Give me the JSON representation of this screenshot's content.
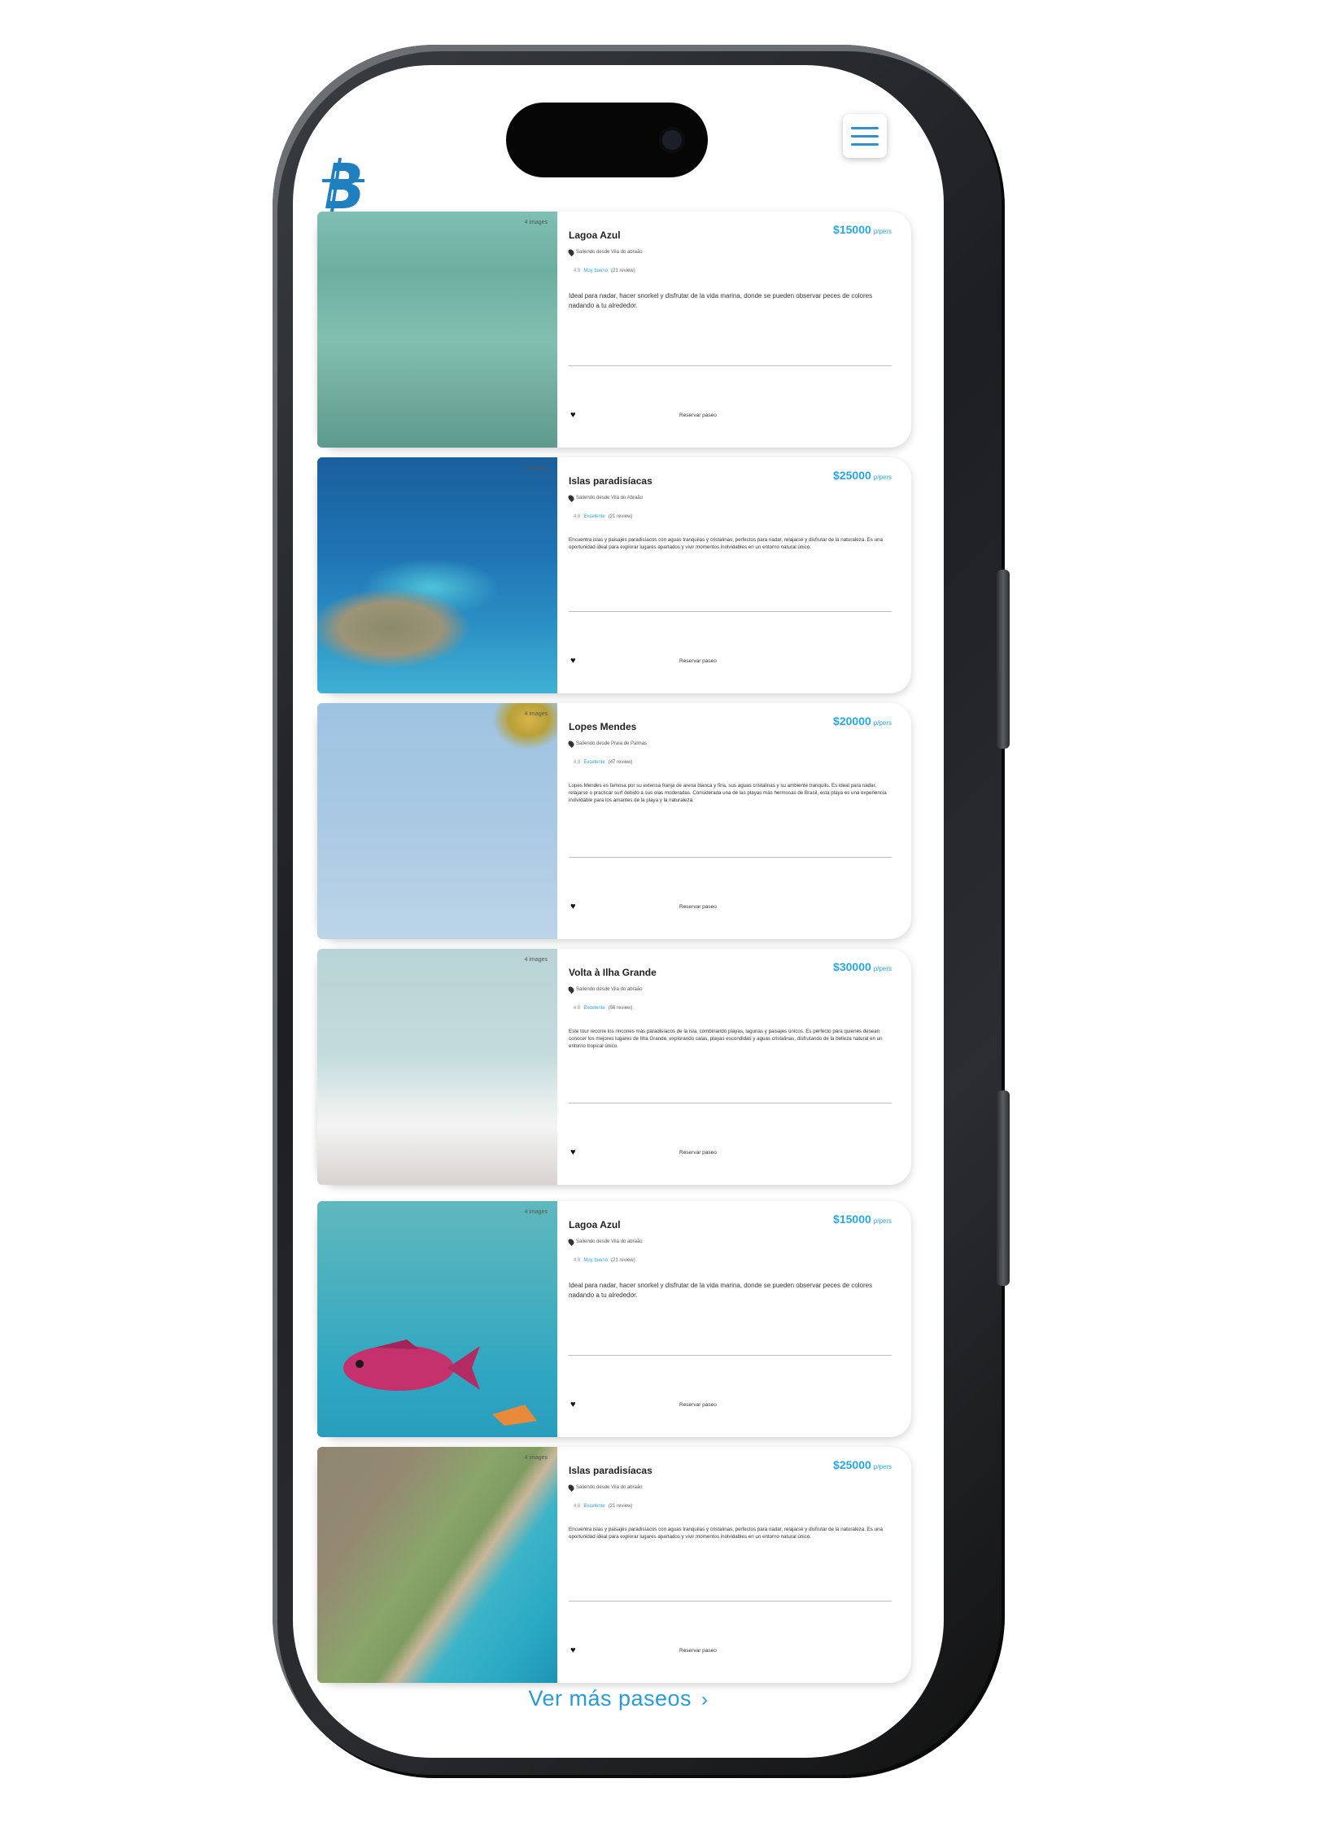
{
  "header": {
    "logo_icon": "brand-b-logo-icon",
    "menu_icon": "hamburger-menu-icon"
  },
  "accent_color": "#2aa6e0",
  "cards": [
    {
      "image_tag": "4 images",
      "title": "Lagoa Azul",
      "price": "$15000",
      "price_unit": "p/pers",
      "location": "Saliendo desde Vila do abraão",
      "rating_score": "4.9",
      "rating_label": "Muy bueno",
      "rating_reviews": "(21 review)",
      "description": "Ideal para nadar, hacer snorkel y disfrutar de la vida marina, donde se pueden observar peces de colores nadando a tu alrededor.",
      "reserve_label": "Reservar paseo"
    },
    {
      "image_tag": "4 images",
      "title": "Islas paradisíacas",
      "price": "$25000",
      "price_unit": "p/pers",
      "location": "Saliendo desde Vila do Abraão",
      "rating_score": "4.8",
      "rating_label": "Excelente",
      "rating_reviews": "(21 review)",
      "description": "Encuentra islas y paisajes paradisíacos con aguas tranquilas y cristalinas, perfectos para nadar, relajarse y disfrutar de la naturaleza. Es una oportunidad ideal para explorar lugares apartados y vivir momentos inolvidables en un entorno natural único.",
      "reserve_label": "Reservar paseo"
    },
    {
      "image_tag": "4 images",
      "title": "Lopes Mendes",
      "price": "$20000",
      "price_unit": "p/pers",
      "location": "Saliendo desde Praia de Palmas",
      "rating_score": "4.9",
      "rating_label": "Excelente",
      "rating_reviews": "(47 review)",
      "description": "Lopes Mendes es famosa por su extensa franja de arena blanca y fina, sus aguas cristalinas y su ambiente tranquilo. Es ideal para nadar, relajarse o practicar surf debido a sus olas moderadas. Considerada una de las playas más hermosas de Brasil, esta playa es una experiencia inolvidable para los amantes de la playa y la naturaleza.",
      "reserve_label": "Reservar paseo"
    },
    {
      "image_tag": "4 images",
      "title": "Volta à Ilha Grande",
      "price": "$30000",
      "price_unit": "p/pers",
      "location": "Saliendo desde Vila do abraão",
      "rating_score": "4.8",
      "rating_label": "Excelente",
      "rating_reviews": "(56 review)",
      "description": "Este tour recorre los rincones más paradisíacos de la isla, combinando playas, lagunas y paisajes únicos. Es perfecto para quienes desean conocer los mejores lugares de Ilha Grande, explorando calas, playas escondidas y aguas cristalinas, disfrutando de la belleza natural en un entorno tropical único.",
      "reserve_label": "Reservar paseo"
    },
    {
      "image_tag": "4 images",
      "title": "Lagoa Azul",
      "price": "$15000",
      "price_unit": "p/pers",
      "location": "Saliendo desde Vila do abraão",
      "rating_score": "4.9",
      "rating_label": "Muy bueno",
      "rating_reviews": "(21 review)",
      "description": "Ideal para nadar, hacer snorkel y disfrutar de la vida marina, donde se pueden observar peces de colores nadando a tu alrededor.",
      "reserve_label": "Reservar paseo"
    },
    {
      "image_tag": "4 images",
      "title": "Islas paradisíacas",
      "price": "$25000",
      "price_unit": "p/pers",
      "location": "Saliendo desde Vila do abraão",
      "rating_score": "4.8",
      "rating_label": "Excelente",
      "rating_reviews": "(21 review)",
      "description": "Encuentra islas y paisajes paradisíacos con aguas tranquilas y cristalinas, perfectos para nadar, relajarse y disfrutar de la naturaleza. Es una oportunidad ideal para explorar lugares apartados y vivir momentos inolvidables en un entorno natural único.",
      "reserve_label": "Reservar paseo"
    }
  ],
  "more_label": "Ver más paseos",
  "more_icon": "chevron-right-icon"
}
